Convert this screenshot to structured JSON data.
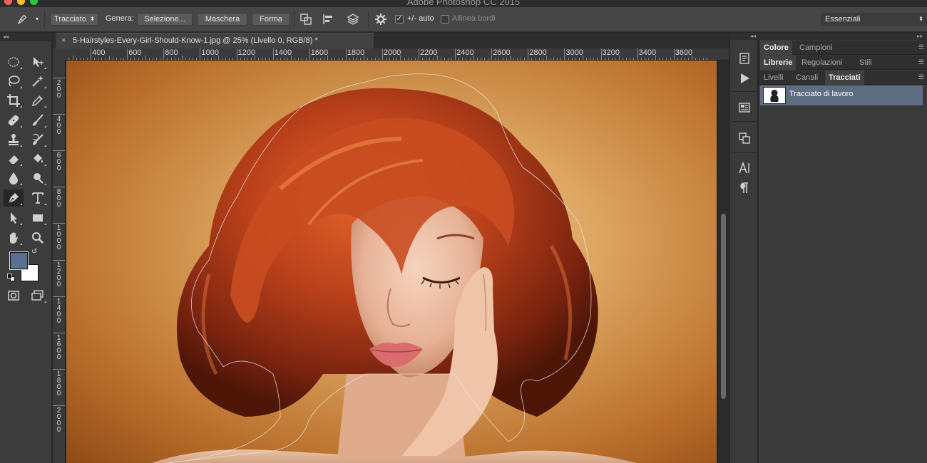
{
  "window": {
    "title": "Adobe Photoshop CC 2015"
  },
  "options_bar": {
    "tool_mode": "Tracciato",
    "make_label": "Genera:",
    "selection_button": "Selezione...",
    "mask_button": "Maschera",
    "shape_button": "Forma",
    "auto_add_delete": "+/- auto",
    "auto_add_delete_checked": true,
    "align_edges": "Allinea bordi",
    "align_edges_checked": false,
    "workspace": "Essenziali"
  },
  "document": {
    "tab_title": "5-Hairstyles-Every-Girl-Should-Know-1.jpg @ 25% (Livello 0, RGB/8) *",
    "close_glyph": "×",
    "h_ruler": [
      "00",
      "400",
      "600",
      "800",
      "1000",
      "1200",
      "1400",
      "1600",
      "1800",
      "2000",
      "2200",
      "2400",
      "2600",
      "2800",
      "3000",
      "3200",
      "3400",
      "3600"
    ],
    "v_ruler": [
      [
        "2",
        "0",
        "0"
      ],
      [
        "4",
        "0",
        "0"
      ],
      [
        "6",
        "0",
        "0"
      ],
      [
        "8",
        "0",
        "0"
      ],
      [
        "1",
        "0",
        "0",
        "0"
      ],
      [
        "1",
        "2",
        "0",
        "0"
      ],
      [
        "1",
        "4",
        "0",
        "0"
      ],
      [
        "1",
        "6",
        "0",
        "0"
      ],
      [
        "1",
        "8",
        "0",
        "0"
      ],
      [
        "2",
        "0",
        "0",
        "0"
      ]
    ]
  },
  "tools": [
    "marquee-tool",
    "move-tool",
    "lasso-tool",
    "magic-wand-tool",
    "crop-tool",
    "eyedropper-tool",
    "healing-brush-tool",
    "brush-tool",
    "clone-stamp-tool",
    "history-brush-tool",
    "eraser-tool",
    "paint-bucket-tool",
    "blur-tool",
    "dodge-tool",
    "pen-tool",
    "type-tool",
    "path-selection-tool",
    "rectangle-tool",
    "hand-tool",
    "zoom-tool"
  ],
  "active_tool": "pen-tool",
  "colors": {
    "foreground": "#5b6f8e",
    "background": "#ffffff",
    "selection": "#5d6d82"
  },
  "panels": {
    "group1": {
      "tabs": [
        "Colore",
        "Campioni"
      ],
      "active": "Colore"
    },
    "group2": {
      "tabs": [
        "Librerie",
        "Regolazioni",
        "Stili"
      ],
      "active": "Librerie"
    },
    "group3": {
      "tabs": [
        "Livelli",
        "Canali",
        "Tracciati"
      ],
      "active": "Tracciati"
    },
    "paths": [
      {
        "name": "Tracciato di lavoro"
      }
    ]
  }
}
